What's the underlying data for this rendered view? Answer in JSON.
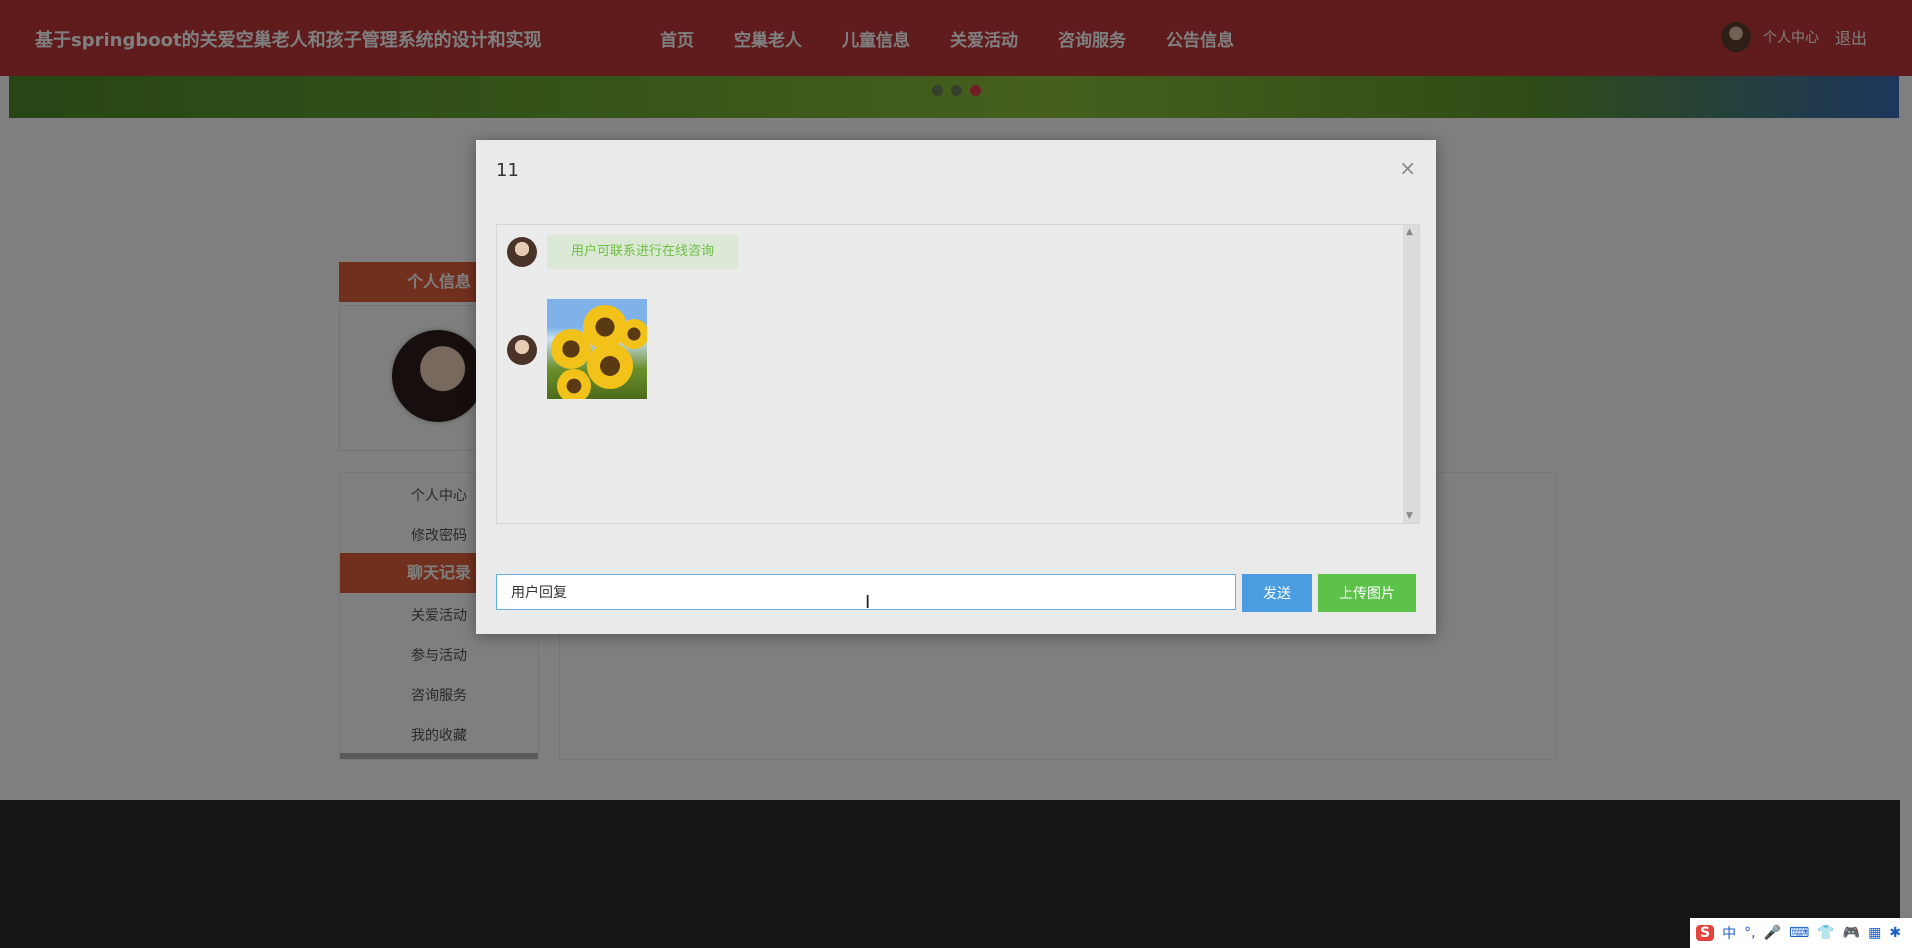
{
  "site": {
    "title": "基于springboot的关爱空巢老人和孩子管理系统的设计和实现"
  },
  "nav": {
    "items": [
      "首页",
      "空巢老人",
      "儿童信息",
      "关爱活动",
      "咨询服务",
      "公告信息"
    ]
  },
  "user": {
    "center_label": "个人中心",
    "logout_label": "退出"
  },
  "sidebar": {
    "section_personal": "个人信息",
    "section_chat": "聊天记录",
    "items": [
      "个人中心",
      "修改密码",
      "关爱活动",
      "参与活动",
      "咨询服务",
      "我的收藏"
    ]
  },
  "modal": {
    "title": "11",
    "close_symbol": "×",
    "messages": [
      {
        "type": "text",
        "text": "用户可联系进行在线咨询"
      },
      {
        "type": "image",
        "description": "sunflowers"
      }
    ],
    "input_value": "用户回复",
    "send_label": "发送",
    "upload_label": "上传图片"
  },
  "ime": {
    "items": [
      "S",
      "中",
      "°,",
      "🎤",
      "⌨",
      "👕",
      "🎮",
      "▦",
      "✱"
    ]
  },
  "colors": {
    "header": "#c0393b",
    "sidebar_head": "#e2603b",
    "send_button": "#4a9de0",
    "upload_button": "#5cc24a",
    "bubble_text": "#6fbf45"
  }
}
